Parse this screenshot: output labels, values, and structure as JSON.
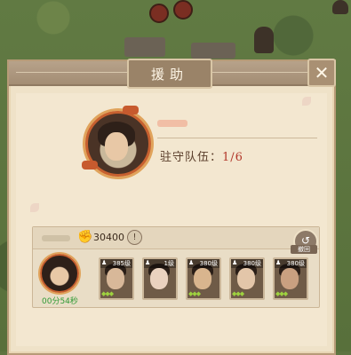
{
  "dialog": {
    "title": "援助",
    "close_icon": "close-icon"
  },
  "hero": {
    "garrison_label": "驻守队伍：",
    "garrison_count": "1/6"
  },
  "team": {
    "power_icon": "power-fist-icon",
    "power_value": "30400",
    "info_icon": "info-icon",
    "info_glyph": "!",
    "recall_icon": "recall-icon",
    "recall_label": "撤回",
    "leader_timer": "00分54秒",
    "members": [
      {
        "level": "385级",
        "skin": "#d8b899",
        "stars": "◆◆◆"
      },
      {
        "level": "1级",
        "skin": "#ead2bf",
        "stars": ""
      },
      {
        "level": "380级",
        "skin": "#d9b58e",
        "stars": "◆◆◆"
      },
      {
        "level": "380级",
        "skin": "#e3c6a9",
        "stars": "◆◆◆"
      },
      {
        "level": "380级",
        "skin": "#c9a080",
        "stars": "◆◆◆"
      }
    ]
  },
  "colors": {
    "panel_bg": "#efe2c8",
    "title_bar": "#a38d74",
    "accent_red": "#b2372a",
    "timer_green": "#2f9a34"
  }
}
